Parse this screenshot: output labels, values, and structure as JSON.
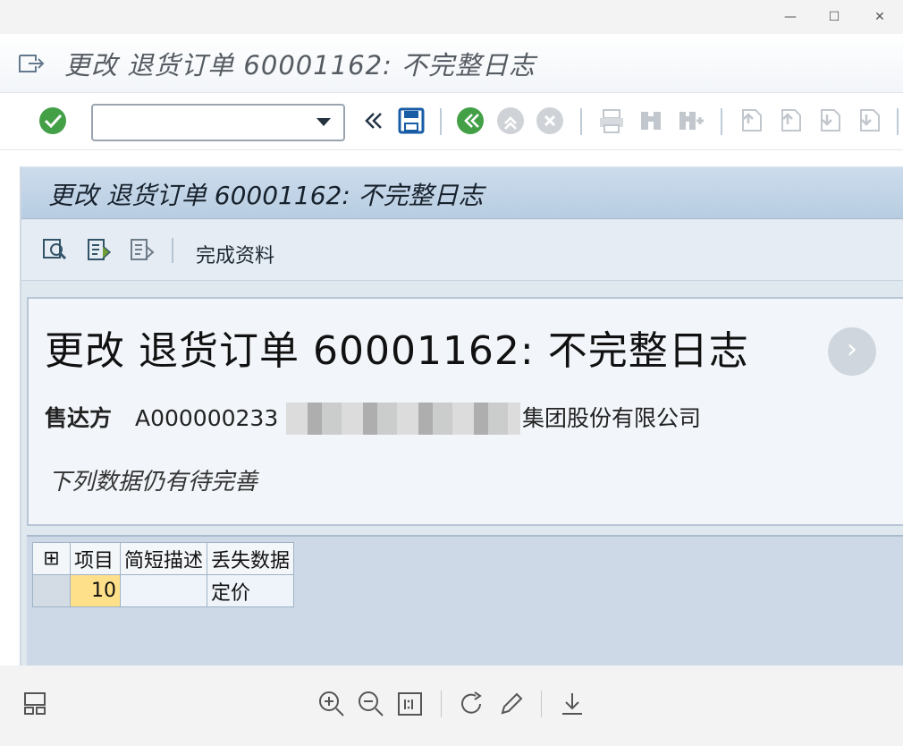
{
  "window": {
    "title": "更改 退货订单 60001162: 不完整日志",
    "controls": [
      "minimize-icon",
      "maximize-icon",
      "close-icon"
    ]
  },
  "toolbar": {
    "command_field_value": "",
    "icons": [
      "check-icon",
      "dropdown-icon",
      "back-double-icon",
      "save-icon",
      "back-icon",
      "exit-icon",
      "cancel-icon",
      "print-icon",
      "find-icon",
      "find-next-icon",
      "first-page-icon",
      "previous-page-icon",
      "next-page-icon",
      "last-page-icon"
    ]
  },
  "subheader": {
    "title": "更改 退货订单 60001162: 不完整日志",
    "complete_data_label": "完成资料"
  },
  "panel": {
    "heading": "更改 退货订单 60001162: 不完整日志",
    "sold_to_label": "售达方",
    "sold_to_id": "A000000233",
    "company_suffix": "集团股份有限公司",
    "pending_note": "下列数据仍有待完善"
  },
  "table": {
    "headers": [
      "项目",
      "简短描述",
      "丢失数据"
    ],
    "rows": [
      {
        "item": "10",
        "description": "",
        "missing_data": "定价"
      }
    ]
  },
  "bottombar": {
    "icons": [
      "layout-icon",
      "zoom-in-icon",
      "zoom-out-icon",
      "actual-size-icon",
      "rotate-icon",
      "edit-icon",
      "download-icon"
    ]
  }
}
